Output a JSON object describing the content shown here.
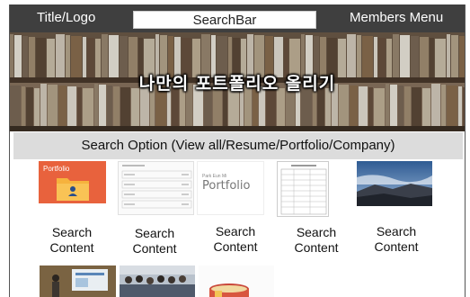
{
  "header": {
    "title_logo": "Title/Logo",
    "search_bar": "SearchBar",
    "members_menu": "Members Menu"
  },
  "banner": {
    "title": "나만의 포트폴리오 올리기"
  },
  "search_option": {
    "label": "Search  Option (View all/Resume/Portfolio/Company)"
  },
  "results": [
    {
      "thumb_text": "Portfolio",
      "line1": "Search",
      "line2": "Content"
    },
    {
      "thumb_text": "",
      "line1": "Search",
      "line2": "Content"
    },
    {
      "thumb_text": "Portfolio",
      "thumb_small": "Park Eun Mi",
      "line1": "Search",
      "line2": "Content"
    },
    {
      "thumb_text": "",
      "line1": "Search",
      "line2": "Content"
    },
    {
      "thumb_text": "",
      "line1": "Search",
      "line2": "Content"
    }
  ],
  "colors": {
    "topbar": "#3f3f3f",
    "option_bar": "#dcdcdc",
    "portfolio_orange": "#e8623d"
  }
}
